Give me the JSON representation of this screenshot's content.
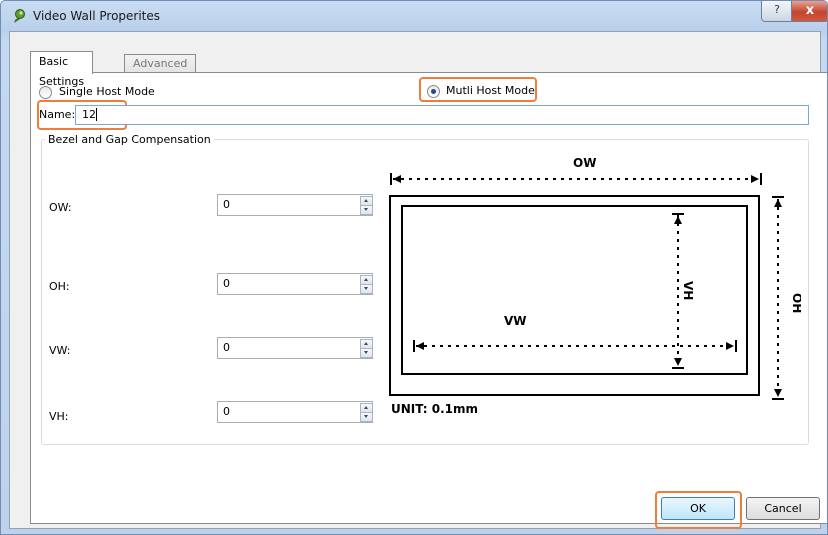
{
  "window": {
    "title": "Video Wall Properites",
    "help_label": "?",
    "close_label": "x"
  },
  "tabs": [
    {
      "label": "Basic Settings",
      "active": true
    },
    {
      "label": "Advanced Settings",
      "active": false
    }
  ],
  "mode": {
    "single_label": "Single Host Mode",
    "multi_label": "Mutli Host Mode",
    "selected": "multi"
  },
  "name_field": {
    "label": "Name:",
    "value": "12"
  },
  "bezel": {
    "title": "Bezel and Gap Compensation",
    "fields": [
      {
        "label": "OW:",
        "value": "0"
      },
      {
        "label": "OH:",
        "value": "0"
      },
      {
        "label": "VW:",
        "value": "0"
      },
      {
        "label": "VH:",
        "value": "0"
      }
    ]
  },
  "diagram": {
    "ow": "OW",
    "oh": "OH",
    "vw": "VW",
    "vh": "VH",
    "unit": "UNIT: 0.1mm"
  },
  "buttons": {
    "ok": "OK",
    "cancel": "Cancel"
  },
  "highlight_color": "#f07d3a"
}
